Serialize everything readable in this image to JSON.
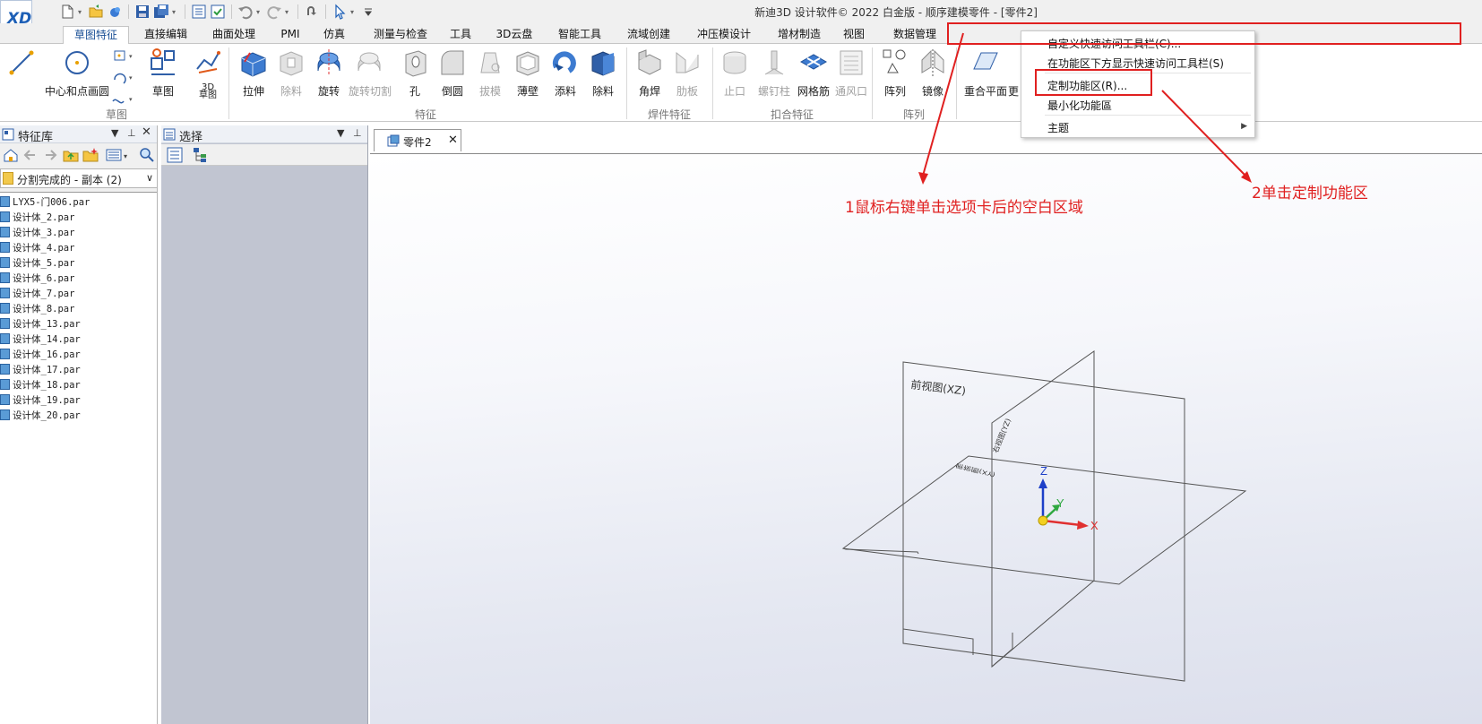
{
  "window": {
    "title": "新迪3D 设计软件© 2022 白金版 - 顺序建模零件 - [零件2]",
    "logo_text": "XD"
  },
  "tabs": [
    {
      "label": "草图特征",
      "active": true
    },
    {
      "label": "直接编辑"
    },
    {
      "label": "曲面处理"
    },
    {
      "label": "PMI"
    },
    {
      "label": "仿真"
    },
    {
      "label": "测量与检查"
    },
    {
      "label": "工具"
    },
    {
      "label": "3D云盘"
    },
    {
      "label": "智能工具"
    },
    {
      "label": "流域创建"
    },
    {
      "label": "冲压模设计"
    },
    {
      "label": "增材制造"
    },
    {
      "label": "视图"
    },
    {
      "label": "数据管理"
    }
  ],
  "ribbon": {
    "sketch_tools": {
      "circle_label": "中心和点画圆",
      "sketch_label": "草图",
      "sketch3d_label": "3D\n草图"
    },
    "buttons": [
      {
        "label": "拉伸",
        "enabled": true
      },
      {
        "label": "除料",
        "enabled": false
      },
      {
        "label": "旋转",
        "enabled": true
      },
      {
        "label": "旋转切割",
        "enabled": false
      },
      {
        "label": "孔",
        "enabled": true
      },
      {
        "label": "倒圆",
        "enabled": true
      },
      {
        "label": "拔模",
        "enabled": false
      },
      {
        "label": "薄壁",
        "enabled": true
      },
      {
        "label": "添料",
        "enabled": true
      },
      {
        "label": "除料",
        "enabled": true
      },
      {
        "label": "角焊",
        "enabled": true
      },
      {
        "label": "肋板",
        "enabled": false
      },
      {
        "label": "止口",
        "enabled": false
      },
      {
        "label": "螺钉柱",
        "enabled": false
      },
      {
        "label": "网格筋",
        "enabled": true
      },
      {
        "label": "通风口",
        "enabled": false
      },
      {
        "label": "阵列",
        "enabled": true
      },
      {
        "label": "镜像",
        "enabled": true
      },
      {
        "label": "重合平面",
        "enabled": true
      },
      {
        "label": "更",
        "enabled": true
      }
    ],
    "groups": [
      "草图",
      "特征",
      "焊件特征",
      "扣合特征",
      "阵列"
    ]
  },
  "feature_library": {
    "title": "特征库",
    "folder": "分割完成的 - 副本 (2)",
    "files": [
      "LYX5-门006.par",
      "设计体_2.par",
      "设计体_3.par",
      "设计体_4.par",
      "设计体_5.par",
      "设计体_6.par",
      "设计体_7.par",
      "设计体_8.par",
      "设计体_13.par",
      "设计体_14.par",
      "设计体_16.par",
      "设计体_17.par",
      "设计体_18.par",
      "设计体_19.par",
      "设计体_20.par"
    ]
  },
  "select_panel": {
    "title": "选择"
  },
  "document": {
    "tab_label": "零件2",
    "planes": {
      "front": "前视图(XZ)",
      "right": "右视图(YZ)",
      "top": "俯视图(XY)"
    },
    "axes": {
      "x": "X",
      "y": "Y",
      "z": "Z"
    }
  },
  "context_menu": {
    "items": [
      {
        "label": "自定义快速访问工具栏(C)..."
      },
      {
        "label": "在功能区下方显示快速访问工具栏(S)"
      },
      {
        "label": "定制功能区(R)..."
      },
      {
        "label": "最小化功能區"
      },
      {
        "label": "主题",
        "submenu": true
      }
    ]
  },
  "annotations": {
    "step1": "1鼠标右键单击选项卡后的空白区域",
    "step2": "2单击定制功能区",
    "color": "#e02020"
  },
  "colors": {
    "accent": "#1a4f95",
    "annotation": "#e02020"
  }
}
